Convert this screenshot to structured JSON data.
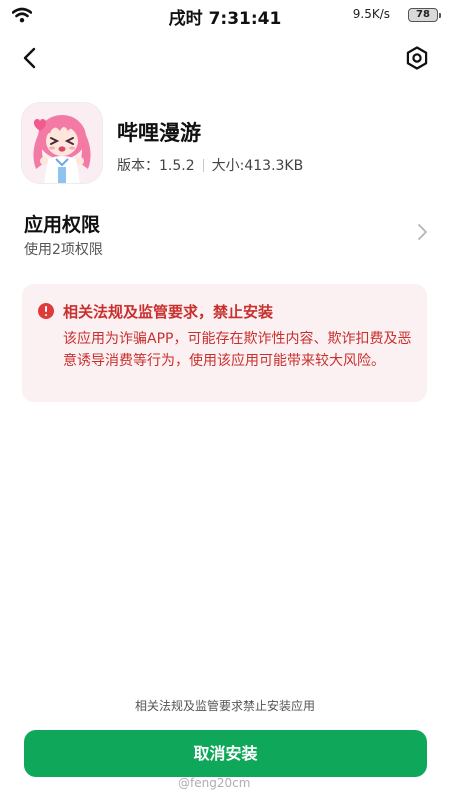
{
  "status_bar": {
    "time": "戌时 7:31:41",
    "net_speed": "9.5K/s",
    "battery": "78"
  },
  "nav": {
    "back_icon": "chevron-left-icon",
    "settings_icon": "hexagon-gear-icon"
  },
  "app": {
    "name": "哔哩漫游",
    "version": "版本：1.5.2",
    "size": "大小:413.3KB",
    "icon": "anime-girl-app-icon"
  },
  "permissions": {
    "title": "应用权限",
    "subtitle": "使用2项权限"
  },
  "warning": {
    "title": "相关法规及监管要求，禁止安装",
    "body": "该应用为诈骗APP，可能存在欺诈性内容、欺诈扣费及恶意诱导消费等行为，使用该应用可能带来较大风险。",
    "color": "#c8302e",
    "background": "#fcf1f2"
  },
  "footer": {
    "note": "相关法规及监管要求禁止安装应用",
    "cancel_label": "取消安装",
    "button_color": "#0fa85a"
  },
  "watermark": "@feng20cm"
}
